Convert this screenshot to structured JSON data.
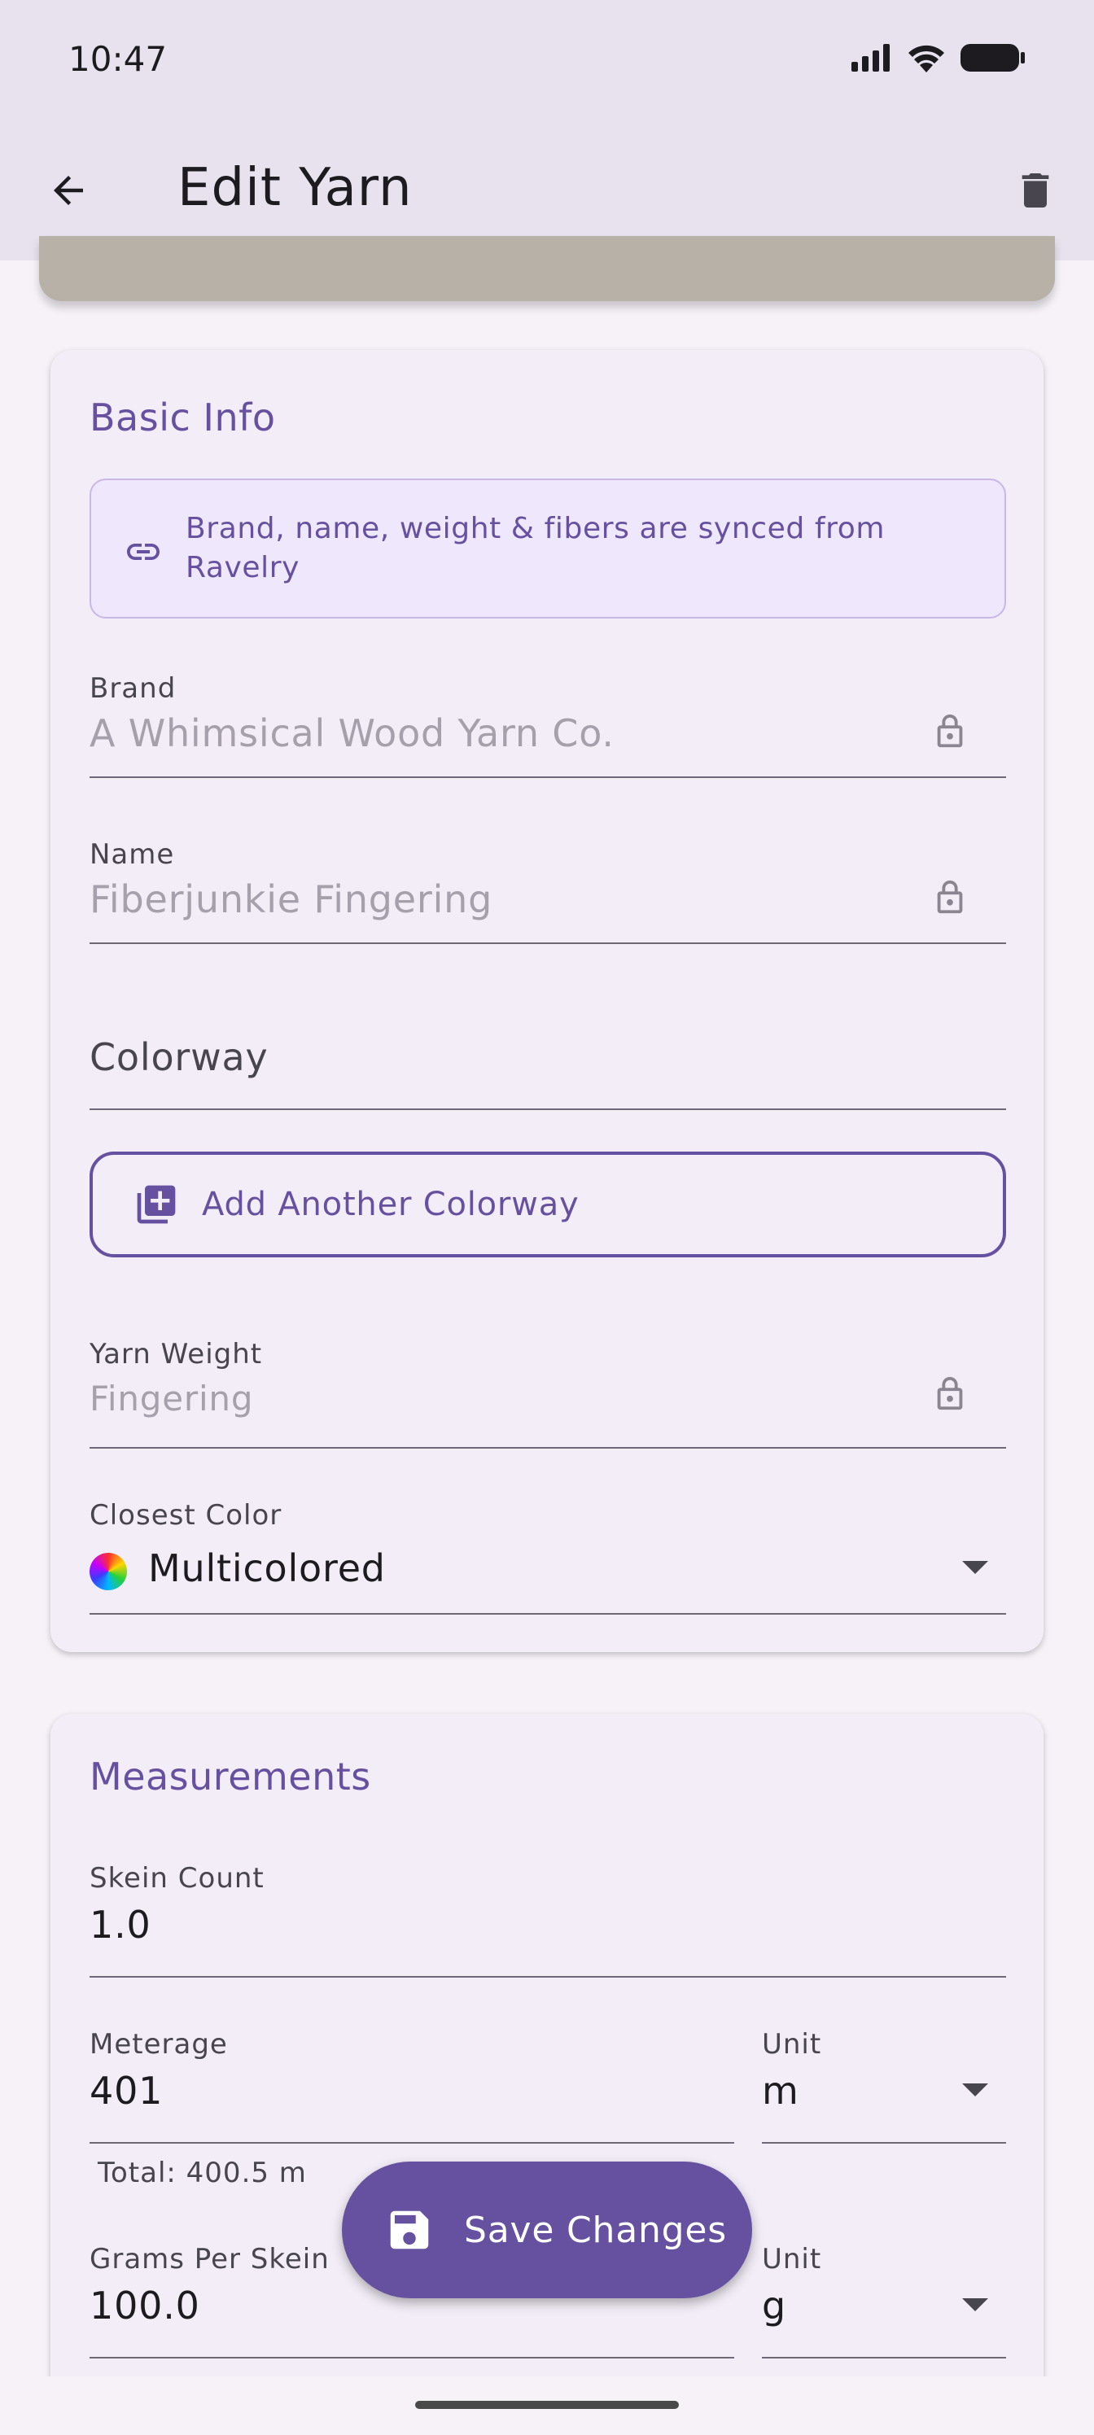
{
  "status_bar": {
    "time": "10:47",
    "icons": [
      "signal-icon",
      "wifi-icon",
      "battery-icon"
    ]
  },
  "app_bar": {
    "title": "Edit Yarn",
    "back_icon": "arrow-back-icon",
    "delete_icon": "trash-icon"
  },
  "basic_info": {
    "title": "Basic Info",
    "sync_notice": "Brand, name, weight & fibers are synced from Ravelry",
    "brand": {
      "label": "Brand",
      "value": "A Whimsical Wood Yarn Co.",
      "locked": true
    },
    "name": {
      "label": "Name",
      "value": "Fiberjunkie Fingering",
      "locked": true
    },
    "colorway": {
      "placeholder": "Colorway",
      "value": ""
    },
    "add_colorway_label": "Add Another Colorway",
    "yarn_weight": {
      "label": "Yarn Weight",
      "value": "Fingering",
      "locked": true
    },
    "closest_color": {
      "label": "Closest Color",
      "value": "Multicolored"
    }
  },
  "measurements": {
    "title": "Measurements",
    "skein_count": {
      "label": "Skein Count",
      "value": "1.0"
    },
    "meterage": {
      "label": "Meterage",
      "value": "401",
      "helper": "Total: 400.5 m"
    },
    "meterage_unit": {
      "label": "Unit",
      "value": "m"
    },
    "grams_per_skein": {
      "label": "Grams Per Skein",
      "value": "100.0"
    },
    "grams_unit": {
      "label": "Unit",
      "value": "g"
    }
  },
  "fab": {
    "label": "Save Changes",
    "icon": "save-icon"
  },
  "colors": {
    "primary": "#65519f",
    "surface": "#f6f2f8",
    "card": "#f3edf7",
    "app_bar": "#e8e2ef",
    "info_bg": "#efe7fc"
  }
}
